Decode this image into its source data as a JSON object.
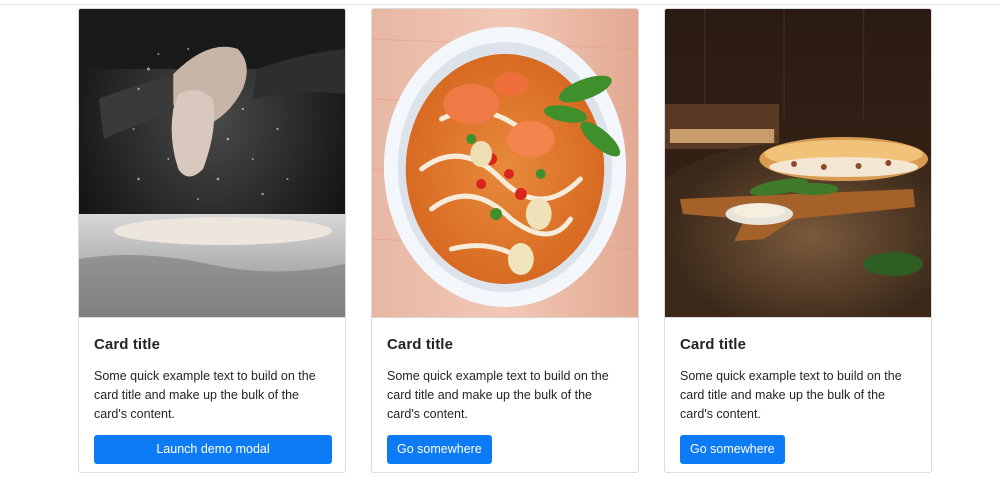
{
  "cards": [
    {
      "image_alt": "hands clapping flour over pizza dough",
      "title": "Card title",
      "text": "Some quick example text to build on the card title and make up the bulk of the card's content.",
      "button_label": "Launch demo modal"
    },
    {
      "image_alt": "bowl of noodle soup with shrimp and herbs",
      "title": "Card title",
      "text": "Some quick example text to build on the card title and make up the bulk of the card's content.",
      "button_label": "Go somewhere"
    },
    {
      "image_alt": "baguette sandwich on wooden board with sauce",
      "title": "Card title",
      "text": "Some quick example text to build on the card title and make up the bulk of the card's content.",
      "button_label": "Go somewhere"
    }
  ],
  "colors": {
    "button": "#0d7bf6",
    "border": "#dcdcdc"
  }
}
